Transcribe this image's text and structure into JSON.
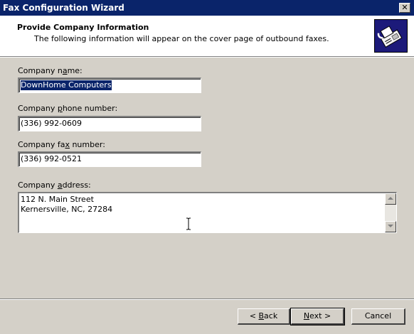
{
  "window": {
    "title": "Fax Configuration Wizard",
    "close_label": "✕"
  },
  "header": {
    "title": "Provide Company Information",
    "subtitle": "The following information will appear on the cover page of outbound faxes.",
    "icon": "fax-machine-icon"
  },
  "form": {
    "company_name": {
      "label_pre": "Company n",
      "label_ul": "a",
      "label_post": "me:",
      "value": "DownHome Computers"
    },
    "company_phone": {
      "label_pre": "Company ",
      "label_ul": "p",
      "label_post": "hone number:",
      "value": "(336) 992-0609"
    },
    "company_fax": {
      "label_pre": "Company fa",
      "label_ul": "x",
      "label_post": " number:",
      "value": "(336) 992-0521"
    },
    "company_address": {
      "label_pre": "Company ",
      "label_ul": "a",
      "label_post": "ddress:",
      "lines": [
        "112 N. Main Street",
        "Kernersville, NC, 27284"
      ]
    }
  },
  "buttons": {
    "back": {
      "pre": "< ",
      "ul": "B",
      "post": "ack"
    },
    "next": {
      "ul": "N",
      "post": "ext >"
    },
    "cancel": "Cancel"
  },
  "colors": {
    "titlebar": "#0a246a",
    "face": "#d4d0c8",
    "selection": "#0a246a"
  }
}
